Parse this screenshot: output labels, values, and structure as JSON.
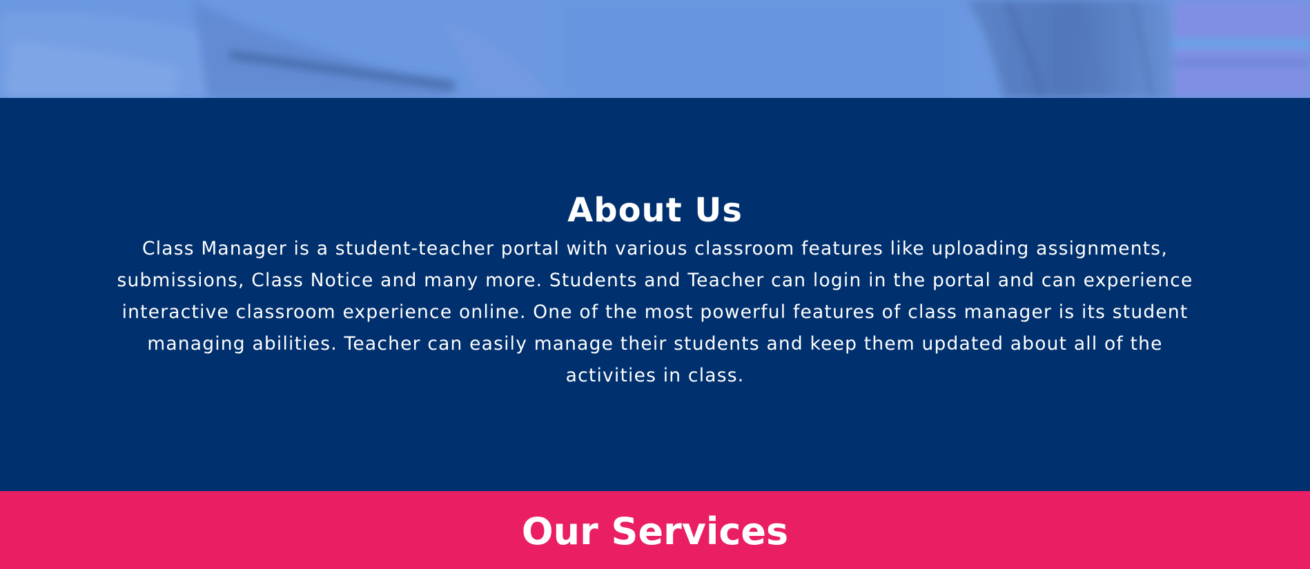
{
  "hero": {
    "image_description_icon": "classroom-photo-image",
    "overlay_color": "#6f9be0"
  },
  "about": {
    "title": "About Us",
    "body": "Class Manager is a student-teacher portal with various classroom features like uploading assignments, submissions, Class Notice and many more. Students and Teacher can login in the portal and can experience interactive classroom experience online. One of the most powerful features of class manager is its student managing abilities. Teacher can easily manage their students and keep them updated about all of the activities in class.",
    "background_color": "#00306e"
  },
  "services": {
    "title": "Our Services",
    "background_color": "#e91e63"
  }
}
